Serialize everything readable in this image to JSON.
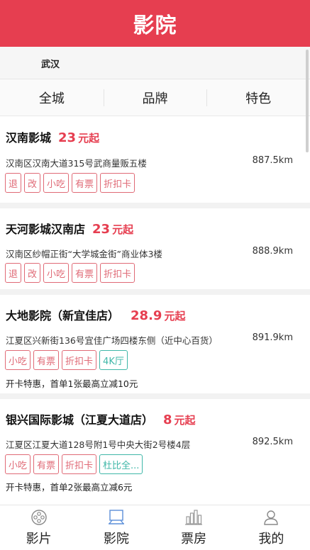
{
  "header": {
    "title": "影院"
  },
  "city": {
    "name": "武汉"
  },
  "filters": [
    {
      "label": "全城"
    },
    {
      "label": "品牌"
    },
    {
      "label": "特色"
    }
  ],
  "cinemas": [
    {
      "name": "汉南影城",
      "price": "23",
      "price_unit": "元起",
      "address": "汉南区汉南大道315号武商量贩五楼",
      "distance": "887.5km",
      "tags": [
        {
          "text": "退",
          "style": "red"
        },
        {
          "text": "改",
          "style": "red"
        },
        {
          "text": "小吃",
          "style": "red"
        },
        {
          "text": "有票",
          "style": "red"
        },
        {
          "text": "折扣卡",
          "style": "red"
        }
      ],
      "promo": ""
    },
    {
      "name": "天河影城汉南店",
      "price": "23",
      "price_unit": "元起",
      "address": "汉南区纱帽正街“大学城金街”商业体3楼",
      "distance": "888.9km",
      "tags": [
        {
          "text": "退",
          "style": "red"
        },
        {
          "text": "改",
          "style": "red"
        },
        {
          "text": "小吃",
          "style": "red"
        },
        {
          "text": "有票",
          "style": "red"
        },
        {
          "text": "折扣卡",
          "style": "red"
        }
      ],
      "promo": ""
    },
    {
      "name": "大地影院（新宜佳店）",
      "price": "28.9",
      "price_unit": "元起",
      "address": "江夏区兴新街136号宜佳广场四楼东侧（近中心百货）",
      "distance": "891.9km",
      "tags": [
        {
          "text": "小吃",
          "style": "red"
        },
        {
          "text": "有票",
          "style": "red"
        },
        {
          "text": "折扣卡",
          "style": "red"
        },
        {
          "text": "4K厅",
          "style": "teal"
        }
      ],
      "promo": "开卡特惠，首单1张最高立减10元"
    },
    {
      "name": "银兴国际影城（江夏大道店）",
      "price": "8",
      "price_unit": "元起",
      "address": "江夏区江夏大道128号附1号中央大街2号楼4层",
      "distance": "892.5km",
      "tags": [
        {
          "text": "小吃",
          "style": "red"
        },
        {
          "text": "有票",
          "style": "red"
        },
        {
          "text": "折扣卡",
          "style": "red"
        },
        {
          "text": "杜比全...",
          "style": "teal"
        }
      ],
      "promo": "开卡特惠，首单2张最高立减6元"
    }
  ],
  "tabbar": [
    {
      "label": "影片",
      "icon": "film-reel-icon",
      "active": false
    },
    {
      "label": "影院",
      "icon": "cinema-screen-icon",
      "active": true
    },
    {
      "label": "票房",
      "icon": "box-office-chart-icon",
      "active": false
    },
    {
      "label": "我的",
      "icon": "user-profile-icon",
      "active": false
    }
  ],
  "colors": {
    "brand": "#e63e50",
    "tag_red": "#e06a76",
    "tag_teal": "#3fb7a8",
    "active_icon": "#5b8fd9"
  }
}
